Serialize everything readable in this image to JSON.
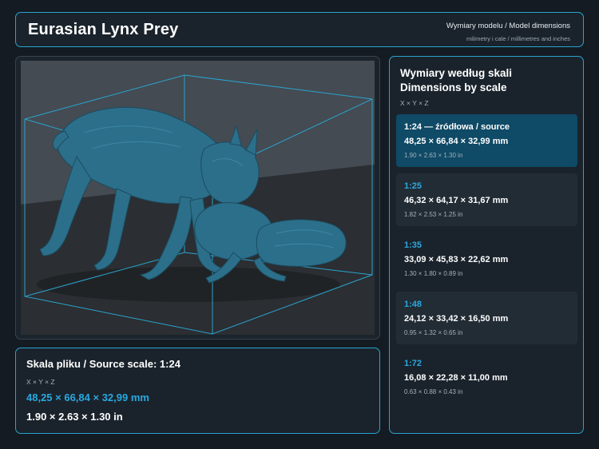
{
  "header": {
    "title": "Eurasian Lynx Prey",
    "subtitle_line1": "Wymiary modelu / Model dimensions",
    "subtitle_line2": "milimetry i cale / millimetres and inches"
  },
  "viewer": {
    "subject": "lynx-with-prey-3d-model",
    "model_color": "#2c6f8a",
    "bbox_color": "#2aa3cf"
  },
  "source": {
    "title": "Skala pliku / Source scale: 1:24",
    "axes": "X × Y × Z",
    "mm": "48,25 × 66,84 × 32,99 mm",
    "inches": "1.90 × 2.63 × 1.30 in"
  },
  "scales": {
    "title_line1": "Wymiary według skali",
    "title_line2": "Dimensions by scale",
    "axes": "X × Y × Z",
    "items": [
      {
        "label": "1:24  —  źródłowa / source",
        "mm": "48,25 × 66,84 × 32,99 mm",
        "inches": "1.90 × 2.63 × 1.30 in",
        "selected": true
      },
      {
        "label": "1:25",
        "mm": "46,32 × 64,17 × 31,67 mm",
        "inches": "1.82 × 2.53 × 1.25 in",
        "selected": false
      },
      {
        "label": "1:35",
        "mm": "33,09 × 45,83 × 22,62 mm",
        "inches": "1.30 × 1.80 × 0.89 in",
        "selected": false
      },
      {
        "label": "1:48",
        "mm": "24,12 × 33,42 × 16,50 mm",
        "inches": "0.95 × 1.32 × 0.65 in",
        "selected": false
      },
      {
        "label": "1:72",
        "mm": "16,08 × 22,28 × 11,00 mm",
        "inches": "0.63 × 0.88 × 0.43 in",
        "selected": false
      }
    ]
  },
  "colors": {
    "accent": "#2aa3cf",
    "selected_card": "#0f4a66",
    "background": "#141b22"
  }
}
